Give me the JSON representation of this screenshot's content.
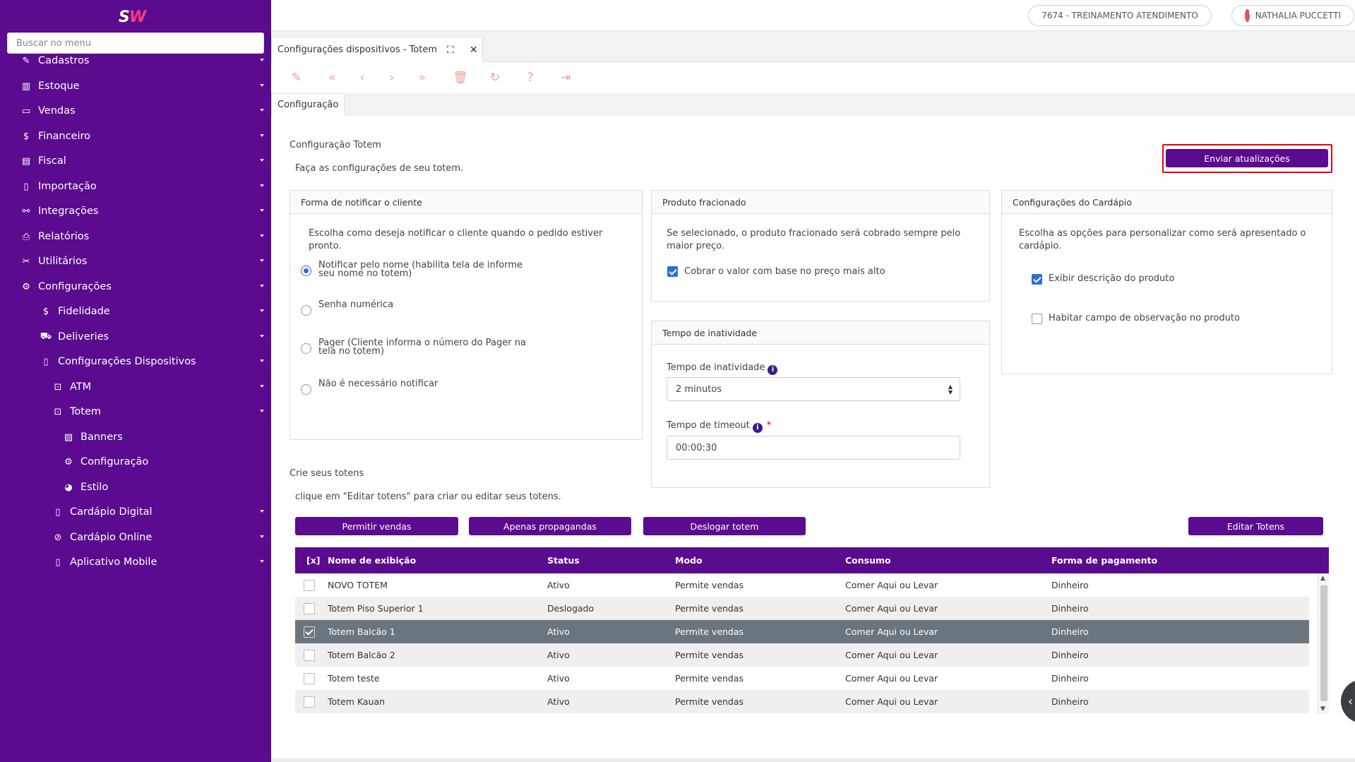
{
  "sidebar": {
    "logo_s": "S",
    "logo_w": "W",
    "search_placeholder": "Buscar no menu",
    "items": [
      {
        "icon": "✎",
        "label": "Cadastros"
      },
      {
        "icon": "▥",
        "label": "Estoque"
      },
      {
        "icon": "▭",
        "label": "Vendas"
      },
      {
        "icon": "$",
        "label": "Financeiro"
      },
      {
        "icon": "▤",
        "label": "Fiscal"
      },
      {
        "icon": "▯",
        "label": "Importação"
      },
      {
        "icon": "⚯",
        "label": "Integrações"
      },
      {
        "icon": "⎙",
        "label": "Relatórios"
      },
      {
        "icon": "✂",
        "label": "Utilitários"
      },
      {
        "icon": "⚙",
        "label": "Configurações"
      },
      {
        "icon": "$",
        "label": "Fidelidade"
      },
      {
        "icon": "⛟",
        "label": "Deliveries"
      },
      {
        "icon": "▯",
        "label": "Configurações Dispositivos"
      },
      {
        "icon": "⊡",
        "label": "ATM"
      },
      {
        "icon": "⊡",
        "label": "Totem"
      },
      {
        "icon": "▨",
        "label": "Banners"
      },
      {
        "icon": "⚙",
        "label": "Configuração"
      },
      {
        "icon": "◕",
        "label": "Estilo"
      },
      {
        "icon": "▯",
        "label": "Cardápio Digital"
      },
      {
        "icon": "⊘",
        "label": "Cardápio Online"
      },
      {
        "icon": "▯",
        "label": "Aplicativo Mobile"
      }
    ]
  },
  "topbar": {
    "company": "7674 - TREINAMENTO ATENDIMENTO",
    "user": "NATHALIA PUCCETTI"
  },
  "tab": {
    "title": "Configurações dispositivos - Totem",
    "expand_icon": "⛶",
    "close_icon": "✕"
  },
  "toolbar": [
    "✎",
    "«",
    "‹",
    "›",
    "»",
    "🗑",
    "↻",
    "?",
    "⇥"
  ],
  "subtab": "Configuração",
  "config": {
    "title": "Configuração Totem",
    "subtitle": "Faça as configurações de seu totem.",
    "send_button": "Enviar atualizações"
  },
  "notify_panel": {
    "header": "Forma de notificar o cliente",
    "desc": "Escolha como deseja notificar o cliente quando o pedido estiver pronto.",
    "options": [
      {
        "label": "Notificar pelo nome (habilita tela de informe seu nome no totem)",
        "selected": true
      },
      {
        "label": "Senha numérica",
        "selected": false
      },
      {
        "label": "Pager (Cliente informa o número do Pager na tela no totem)",
        "selected": false
      },
      {
        "label": "Não é necessário notificar",
        "selected": false
      }
    ]
  },
  "fraction_panel": {
    "header": "Produto fracionado",
    "desc": "Se selecionado, o produto fracionado será cobrado sempre pelo maior preço.",
    "checkbox": "Cobrar o valor com base no preço mais alto"
  },
  "inactivity_panel": {
    "header": "Tempo de inatividade",
    "inactivity_label": "Tempo de inatividade",
    "inactivity_value": "2 minutos",
    "timeout_label": "Tempo de timeout",
    "required": "*",
    "timeout_value": "00:00:30"
  },
  "menu_panel": {
    "header": "Configurações do Cardápio",
    "desc": "Escolha as opções para personalizar como será apresentado o cardápio.",
    "options": [
      {
        "label": "Exibir descrição do produto",
        "checked": true
      },
      {
        "label": "Habitar campo de observação no produto",
        "checked": false
      }
    ]
  },
  "totens": {
    "title": "Crie seus totens",
    "hint": "clique em \"Editar totens\" para criar ou editar seus totens.",
    "buttons": {
      "allow_sales": "Permitir vendas",
      "ads_only": "Apenas propagandas",
      "logout": "Deslogar totem",
      "edit": "Editar Totens"
    },
    "columns": [
      "[x]",
      "Nome de exibição",
      "Status",
      "Modo",
      "Consumo",
      "Forma de pagamento"
    ],
    "rows": [
      {
        "name": "NOVO TOTEM",
        "status": "Ativo",
        "mode": "Permite vendas",
        "consumption": "Comer Aqui ou Levar",
        "payment": "Dinheiro"
      },
      {
        "name": "Totem Piso Superior 1",
        "status": "Deslogado",
        "mode": "Permite vendas",
        "consumption": "Comer Aqui ou Levar",
        "payment": "Dinheiro"
      },
      {
        "name": "Totem Balcão 1",
        "status": "Ativo",
        "mode": "Permite vendas",
        "consumption": "Comer Aqui ou Levar",
        "payment": "Dinheiro",
        "selected": true
      },
      {
        "name": "Totem Balcão 2",
        "status": "Ativo",
        "mode": "Permite vendas",
        "consumption": "Comer Aqui ou Levar",
        "payment": "Dinheiro"
      },
      {
        "name": "Totem teste",
        "status": "Ativo",
        "mode": "Permite vendas",
        "consumption": "Comer Aqui ou Levar",
        "payment": "Dinheiro"
      },
      {
        "name": "Totem Kauan",
        "status": "Ativo",
        "mode": "Permite vendas",
        "consumption": "Comer Aqui ou Levar",
        "payment": "Dinheiro"
      }
    ]
  },
  "colors": {
    "brand": "#5b0b8f",
    "logo_accent": "#ff3b7a",
    "highlight": "#ee0000",
    "selected_row": "#6b757d"
  }
}
